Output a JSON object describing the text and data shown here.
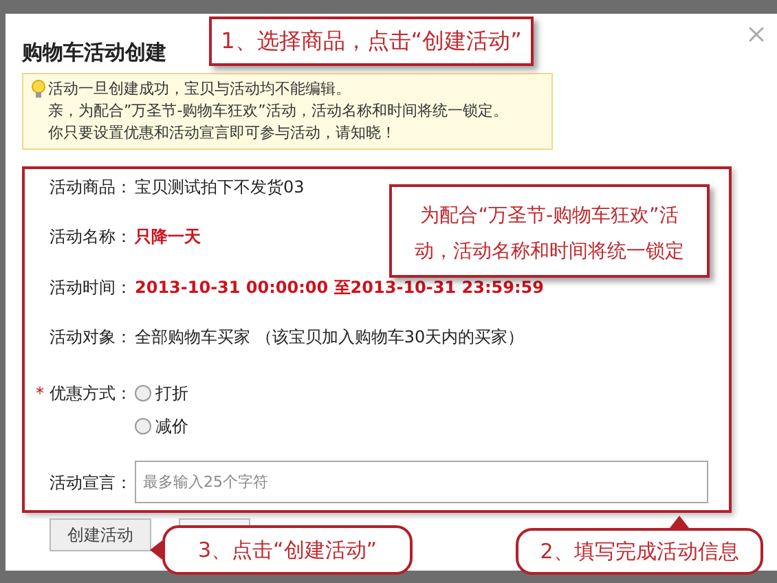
{
  "dialog": {
    "title": "购物车活动创建"
  },
  "notice": {
    "lines": [
      "活动一旦创建成功，宝贝与活动均不能编辑。",
      "亲，为配合”万圣节-购物车狂欢”活动，活动名称和时间将统一锁定。",
      "你只要设置优惠和活动宣言即可参与活动，请知晓！"
    ]
  },
  "form": {
    "required_mark": "*",
    "fields": [
      {
        "kind": "text",
        "label": "活动商品：",
        "value": "宝贝测试拍下不发货03",
        "required": false
      },
      {
        "kind": "locked",
        "label": "活动名称：",
        "value": "只降一天",
        "required": false
      },
      {
        "kind": "locked",
        "label": "活动时间：",
        "value": "2013-10-31 00:00:00 至2013-10-31 23:59:59",
        "required": false
      },
      {
        "kind": "text",
        "label": "活动对象：",
        "value": "全部购物车买家 （该宝贝加入购物车30天内的买家）",
        "required": false
      },
      {
        "kind": "radio",
        "label": "优惠方式：",
        "required": true,
        "options": [
          {
            "label": "打折",
            "selected": false
          },
          {
            "label": "减价",
            "selected": false
          }
        ]
      },
      {
        "kind": "input",
        "label": "活动宣言：",
        "placeholder": "最多输入25个字符",
        "required": false
      }
    ]
  },
  "buttons": [
    {
      "label": "创建活动"
    }
  ],
  "callouts": [
    {
      "kind": "top",
      "text": "1、选择商品，点击“创建活动”"
    },
    {
      "kind": "side",
      "text": "为配合“万圣节-购物车狂欢”活动，活动名称和时间将统一锁定"
    },
    {
      "kind": "left",
      "text": "3、点击“创建活动”"
    },
    {
      "kind": "up",
      "text": "2、填写完成活动信息"
    }
  ]
}
